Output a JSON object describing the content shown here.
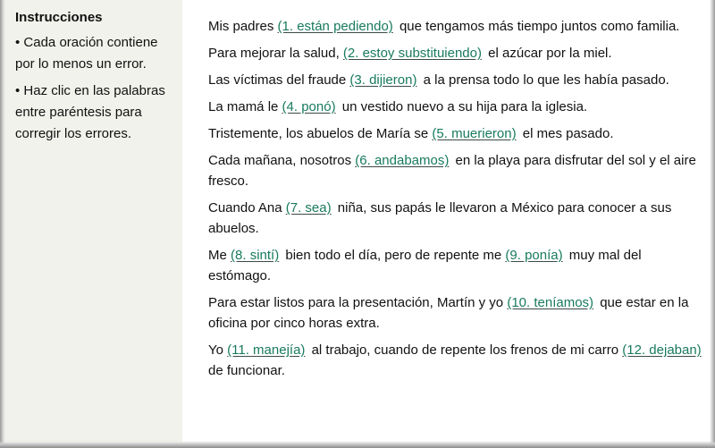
{
  "sidebar": {
    "title": "Instrucciones",
    "items": [
      "• Cada oración contiene por lo menos un error.",
      "• Haz clic en las palabras entre paréntesis para corregir los errores."
    ]
  },
  "colors": {
    "link": "#187a5e",
    "sidebar_bg": "#f2f2ec",
    "text": "#111111"
  },
  "sentences": [
    {
      "parts": [
        {
          "t": "Mis padres "
        },
        {
          "blank": "(1. están pediendo)"
        },
        {
          "t": " que tengamos más tiempo juntos como familia."
        }
      ]
    },
    {
      "parts": [
        {
          "t": "Para mejorar la salud, "
        },
        {
          "blank": "(2. estoy substituiendo)"
        },
        {
          "t": " el azúcar por la miel."
        }
      ]
    },
    {
      "parts": [
        {
          "t": "Las víctimas del fraude "
        },
        {
          "blank": "(3. dijieron)"
        },
        {
          "t": " a la prensa todo lo que les había pasado."
        }
      ]
    },
    {
      "parts": [
        {
          "t": "La mamá le "
        },
        {
          "blank": "(4. ponó)"
        },
        {
          "t": " un vestido nuevo a su hija para la iglesia."
        }
      ]
    },
    {
      "parts": [
        {
          "t": "Tristemente, los abuelos de María se "
        },
        {
          "blank": "(5. muerieron)"
        },
        {
          "t": " el mes pasado."
        }
      ]
    },
    {
      "parts": [
        {
          "t": "Cada mañana, nosotros "
        },
        {
          "blank": "(6. andabamos)"
        },
        {
          "t": " en la playa para disfrutar del sol y el aire fresco."
        }
      ]
    },
    {
      "parts": [
        {
          "t": "Cuando Ana "
        },
        {
          "blank": "(7. sea)"
        },
        {
          "t": " niña, sus papás le llevaron a México para conocer a sus abuelos."
        }
      ]
    },
    {
      "parts": [
        {
          "t": "Me "
        },
        {
          "blank": "(8. sintí)"
        },
        {
          "t": " bien todo el día, pero de repente me "
        },
        {
          "blank": "(9. ponía)"
        },
        {
          "t": " muy mal del estómago."
        }
      ]
    },
    {
      "parts": [
        {
          "t": "Para estar listos para la presentación, Martín y yo "
        },
        {
          "blank": "(10. teníamos)"
        },
        {
          "t": " que estar en la oficina por cinco horas extra."
        }
      ]
    },
    {
      "parts": [
        {
          "t": "Yo "
        },
        {
          "blank": "(11. manejía)"
        },
        {
          "t": " al trabajo, cuando de repente los frenos de mi carro "
        },
        {
          "blank": "(12. dejaban)"
        },
        {
          "t": " de funcionar."
        }
      ]
    }
  ]
}
